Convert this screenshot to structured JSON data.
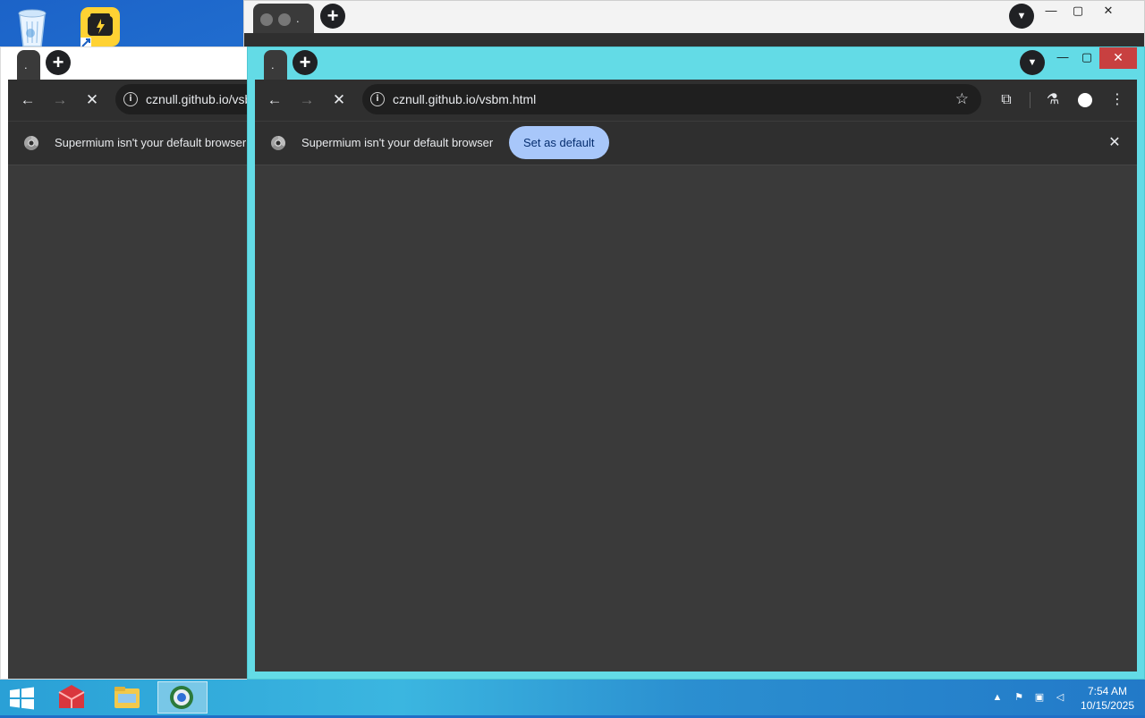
{
  "desktop": {
    "icons": [
      "recycle-bin",
      "app-shortcut"
    ]
  },
  "back_window": {
    "tab_label": "."
  },
  "left_window": {
    "tab_label": ".",
    "url": "cznull.github.io/vsbm.html",
    "infobar_text": "Supermium isn't your default browser"
  },
  "front_window": {
    "tab_label": ".",
    "url": "cznull.github.io/vsbm.html",
    "infobar_text": "Supermium isn't your default browser",
    "set_default_label": "Set as default",
    "accent_color": "#63dbe6"
  },
  "taskbar": {
    "time": "7:54 AM",
    "date": "10/15/2025"
  }
}
